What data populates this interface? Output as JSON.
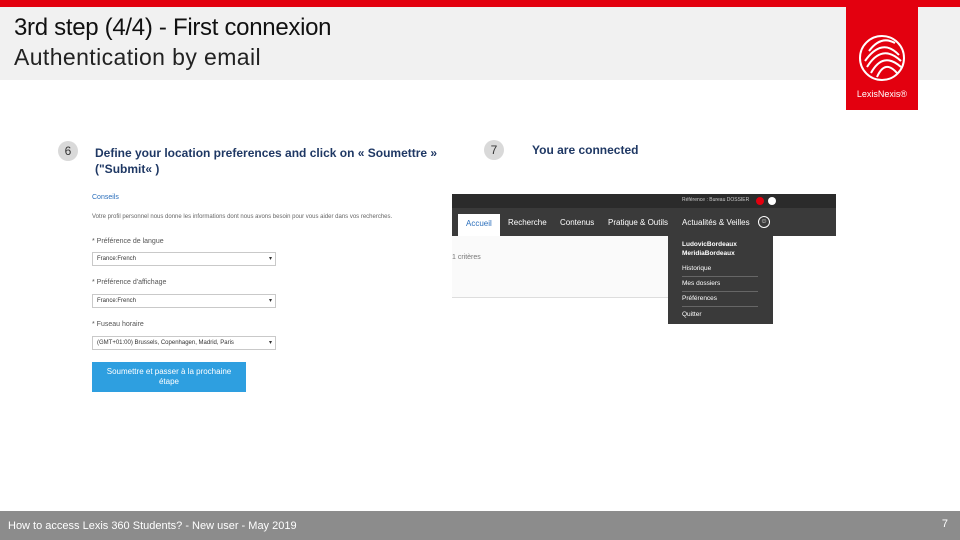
{
  "header": {
    "title": "3rd step (4/4) - First connexion",
    "subtitle": "Authentication by email",
    "logo_text": "LexisNexis®",
    "brand_color": "#e3000f"
  },
  "steps": [
    {
      "number": "6",
      "text_line1": "Define your location preferences and click on « Soumettre »",
      "text_line2": "(\"Submit« )"
    },
    {
      "number": "7",
      "text": "You are connected"
    }
  ],
  "form": {
    "link": "Conseils",
    "description": "Votre profil personnel nous donne les informations dont nous avons besoin pour vous aider dans vos recherches.",
    "language_label": "* Préférence de langue",
    "language_value": "France:French",
    "display_label": "* Préférence d'affichage",
    "display_value": "France:French",
    "timezone_label": "* Fuseau horaire",
    "timezone_value": "(GMT+01:00) Brussels, Copenhagen, Madrid, Paris",
    "submit_line1": "Soumettre et passer à la prochaine",
    "submit_line2": "étape"
  },
  "app": {
    "account": "Référence : Bureau   DOSSIER",
    "tabs": [
      "Accueil",
      "Recherche",
      "Contenus",
      "Pratique & Outils",
      "Actualités & Veilles"
    ],
    "criteria": "1 critères",
    "menu_user_line1": "LudovicBordeaux",
    "menu_user_line2": "MeridiaBordeaux",
    "menu_items": [
      "Historique",
      "Mes dossiers",
      "Préférences",
      "Quitter"
    ]
  },
  "footer": {
    "text": "How to access Lexis 360 Students? - New user - May 2019",
    "page": "7"
  }
}
